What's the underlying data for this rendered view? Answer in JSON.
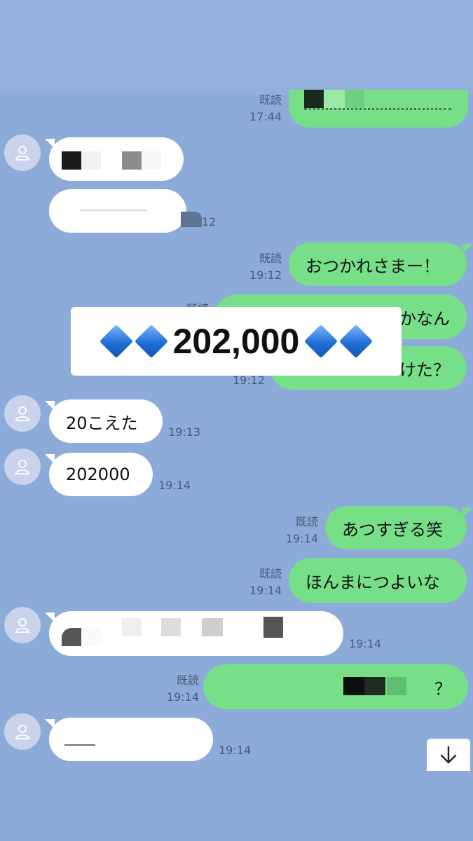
{
  "messages": {
    "m1_read": "既読",
    "m1_time": "17:44",
    "m4_time": "12",
    "m5_text": "おつかれさまー！",
    "m5_read": "既読",
    "m5_time": "19:12",
    "m6_text": "かなん",
    "m6_read": "既読",
    "m7_text": "けた？",
    "m7_time": "19:12",
    "m8_text": "20こえた",
    "m8_time": "19:13",
    "m9_text": "202000",
    "m9_time": "19:14",
    "m10_text": "あつすぎる笑",
    "m10_read": "既読",
    "m10_time": "19:14",
    "m11_text": "ほんまにつよいな",
    "m11_read": "既読",
    "m11_time": "19:14",
    "m12_time": "19:14",
    "m13_text": "？",
    "m13_read": "既読",
    "m13_time": "19:14",
    "m14_time": "19:14"
  },
  "banner": {
    "amount": "202,000"
  },
  "icons": {
    "avatar": "person-icon",
    "scroll": "arrow-down-icon"
  },
  "colors": {
    "background": "#8dabd9",
    "outgoing": "#77df88",
    "incoming": "#ffffff"
  }
}
